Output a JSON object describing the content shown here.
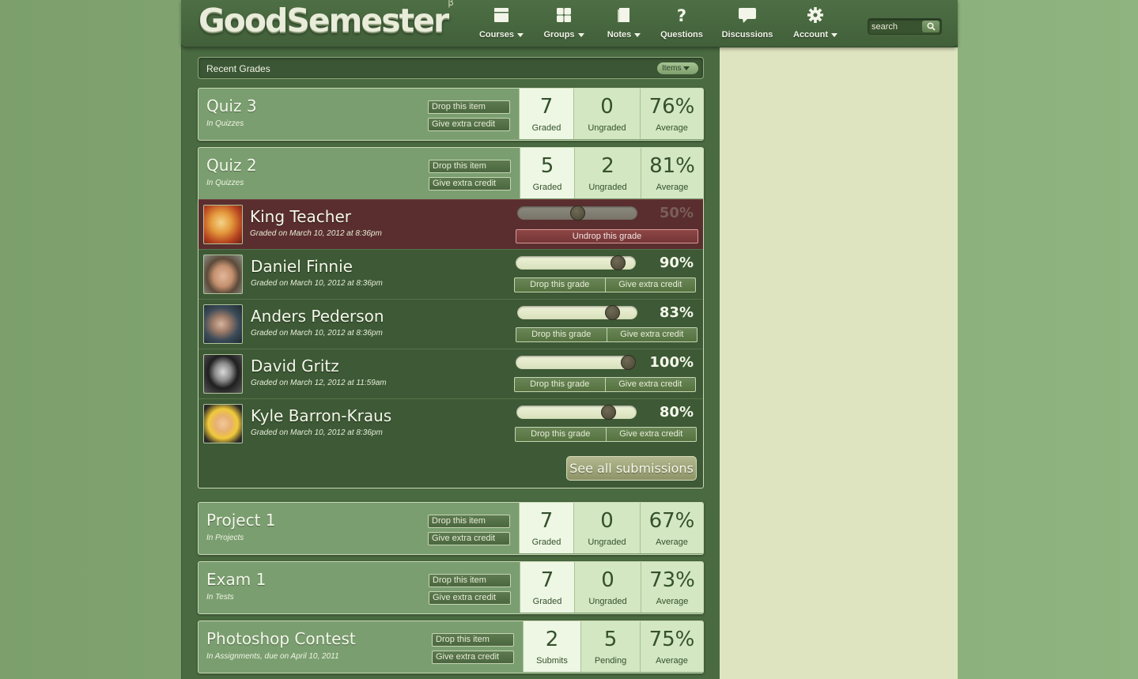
{
  "header": {
    "logo": "GoodSemester",
    "logo_beta": "β",
    "nav": [
      {
        "label": "Courses",
        "icon": "courses-icon",
        "dropdown": true
      },
      {
        "label": "Groups",
        "icon": "groups-icon",
        "dropdown": true
      },
      {
        "label": "Notes",
        "icon": "notes-icon",
        "dropdown": true
      },
      {
        "label": "Questions",
        "icon": "question-icon",
        "dropdown": false
      },
      {
        "label": "Discussions",
        "icon": "discussion-icon",
        "dropdown": false
      },
      {
        "label": "Account",
        "icon": "gear-icon",
        "dropdown": true
      }
    ],
    "search_placeholder": "search"
  },
  "recent": {
    "title": "Recent Grades",
    "filter_label": "Items"
  },
  "items": [
    {
      "title": "Quiz 3",
      "sub": "In Quizzes",
      "drop": "Drop this item",
      "extra": "Give extra credit",
      "stats": [
        {
          "num": "7",
          "label": "Graded"
        },
        {
          "num": "0",
          "label": "Ungraded"
        },
        {
          "num": "76%",
          "label": "Average"
        }
      ]
    },
    {
      "title": "Quiz 2",
      "sub": "In Quizzes",
      "drop": "Drop this item",
      "extra": "Give extra credit",
      "stats": [
        {
          "num": "5",
          "label": "Graded"
        },
        {
          "num": "2",
          "label": "Ungraded"
        },
        {
          "num": "81%",
          "label": "Average"
        }
      ]
    },
    {
      "title": "Project 1",
      "sub": "In Projects",
      "drop": "Drop this item",
      "extra": "Give extra credit",
      "stats": [
        {
          "num": "7",
          "label": "Graded"
        },
        {
          "num": "0",
          "label": "Ungraded"
        },
        {
          "num": "67%",
          "label": "Average"
        }
      ]
    },
    {
      "title": "Exam 1",
      "sub": "In Tests",
      "drop": "Drop this item",
      "extra": "Give extra credit",
      "stats": [
        {
          "num": "7",
          "label": "Graded"
        },
        {
          "num": "0",
          "label": "Ungraded"
        },
        {
          "num": "73%",
          "label": "Average"
        }
      ]
    },
    {
      "title": "Photoshop Contest",
      "sub": "In Assignments, due on April 10, 2011",
      "drop": "Drop this item",
      "extra": "Give extra credit",
      "stats": [
        {
          "num": "2",
          "label": "Submits"
        },
        {
          "num": "5",
          "label": "Pending"
        },
        {
          "num": "75%",
          "label": "Average"
        }
      ]
    }
  ],
  "submissions": [
    {
      "name": "King Teacher",
      "graded": "Graded on March 10, 2012 at 8:36pm",
      "grade": "50%",
      "grade_value": 0.5,
      "dropped": true,
      "undrop": "Undrop this grade"
    },
    {
      "name": "Daniel Finnie",
      "graded": "Graded on March 10, 2012 at 8:36pm",
      "grade": "90%",
      "grade_value": 0.9,
      "drop": "Drop this grade",
      "extra": "Give extra credit"
    },
    {
      "name": "Anders Pederson",
      "graded": "Graded on March 10, 2012 at 8:36pm",
      "grade": "83%",
      "grade_value": 0.83,
      "drop": "Drop this grade",
      "extra": "Give extra credit"
    },
    {
      "name": "David Gritz",
      "graded": "Graded on March 12, 2012 at 11:59am",
      "grade": "100%",
      "grade_value": 1.0,
      "drop": "Drop this grade",
      "extra": "Give extra credit"
    },
    {
      "name": "Kyle Barron-Kraus",
      "graded": "Graded on March 10, 2012 at 8:36pm",
      "grade": "80%",
      "grade_value": 0.8,
      "drop": "Drop this grade",
      "extra": "Give extra credit"
    }
  ],
  "see_all": "See all submissions"
}
